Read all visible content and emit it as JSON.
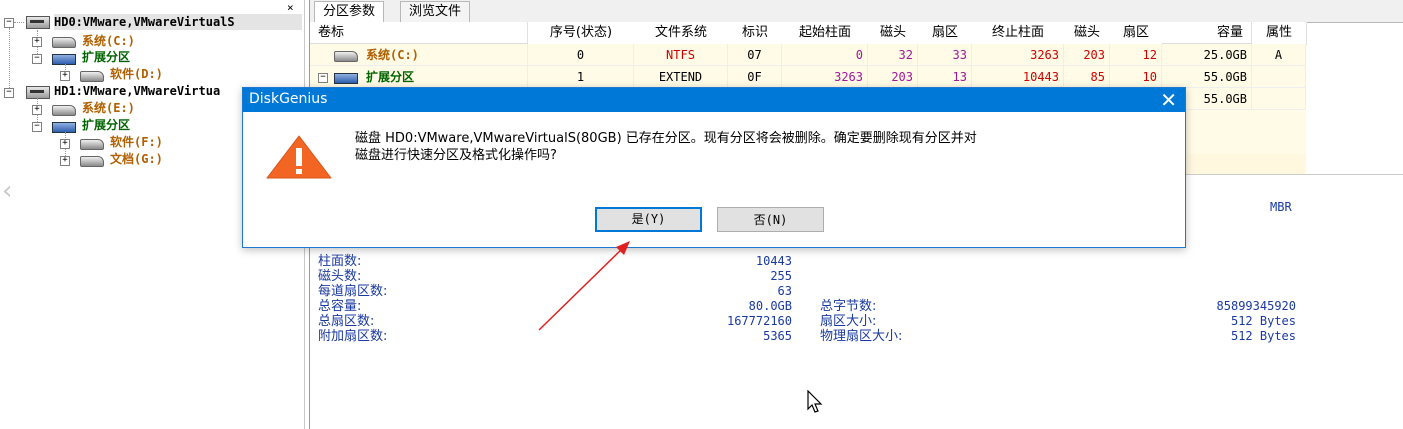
{
  "tree": {
    "close_glyph": "×",
    "nodes": [
      {
        "label": "HD0:VMware,VMwareVirtualS"
      },
      {
        "label": "系统(C:)"
      },
      {
        "label": "扩展分区"
      },
      {
        "label": "软件(D:)"
      },
      {
        "label": "HD1:VMware,VMwareVirtua"
      },
      {
        "label": "系统(E:)"
      },
      {
        "label": "扩展分区"
      },
      {
        "label": "软件(F:)"
      },
      {
        "label": "文档(G:)"
      }
    ]
  },
  "tabs": [
    "分区参数",
    "浏览文件"
  ],
  "table": {
    "headers": [
      "卷标",
      "序号(状态)",
      "文件系统",
      "标识",
      "起始柱面",
      "磁头",
      "扇区",
      "终止柱面",
      "磁头",
      "扇区",
      "容量",
      "属性"
    ],
    "rows": [
      {
        "label": "系统(C:)",
        "index": "0",
        "fs": "NTFS",
        "id": "07",
        "start_cyl": "0",
        "start_head": "32",
        "start_sec": "33",
        "end_cyl": "3263",
        "end_head": "203",
        "end_sec": "12",
        "size": "25.0GB",
        "attr": "A"
      },
      {
        "label": "扩展分区",
        "index": "1",
        "fs": "EXTEND",
        "id": "0F",
        "start_cyl": "3263",
        "start_head": "203",
        "start_sec": "13",
        "end_cyl": "10443",
        "end_head": "85",
        "end_sec": "10",
        "size": "55.0GB",
        "attr": ""
      },
      {
        "label": "",
        "index": "",
        "fs": "",
        "id": "",
        "start_cyl": "",
        "start_head": "",
        "start_sec": "",
        "end_cyl": "",
        "end_head": "",
        "end_sec": "",
        "size": "55.0GB",
        "attr": ""
      }
    ],
    "expand_glyph": "−"
  },
  "disk_info": {
    "partition_style": "MBR",
    "left": [
      {
        "label": "柱面数:",
        "value": "10443"
      },
      {
        "label": "磁头数:",
        "value": "255"
      },
      {
        "label": "每道扇区数:",
        "value": "63"
      },
      {
        "label": "总容量:",
        "value": "80.0GB"
      },
      {
        "label": "总扇区数:",
        "value": "167772160"
      },
      {
        "label": "附加扇区数:",
        "value": "5365"
      }
    ],
    "right": [
      {
        "label": "总字节数:",
        "value": "85899345920"
      },
      {
        "label": "扇区大小:",
        "value": "512 Bytes"
      },
      {
        "label": "物理扇区大小:",
        "value": "512 Bytes"
      }
    ]
  },
  "dialog": {
    "title": "DiskGenius",
    "close_glyph": "✕",
    "message_line1": "磁盘 HD0:VMware,VMwareVirtualS(80GB) 已存在分区。现有分区将会被删除。确定要删除现有分区并对",
    "message_line2": "磁盘进行快速分区及格式化操作吗?",
    "yes_label": "是(Y)",
    "no_label": "否(N)"
  },
  "colors": {
    "title_bar": "#0078d7",
    "warning": "#f26522",
    "annotation_arrow": "#e02020"
  },
  "icons": [
    "warning-icon",
    "disk-icon",
    "partition-icon",
    "extended-partition-icon",
    "mouse-cursor-icon",
    "left-chevron-icon"
  ]
}
